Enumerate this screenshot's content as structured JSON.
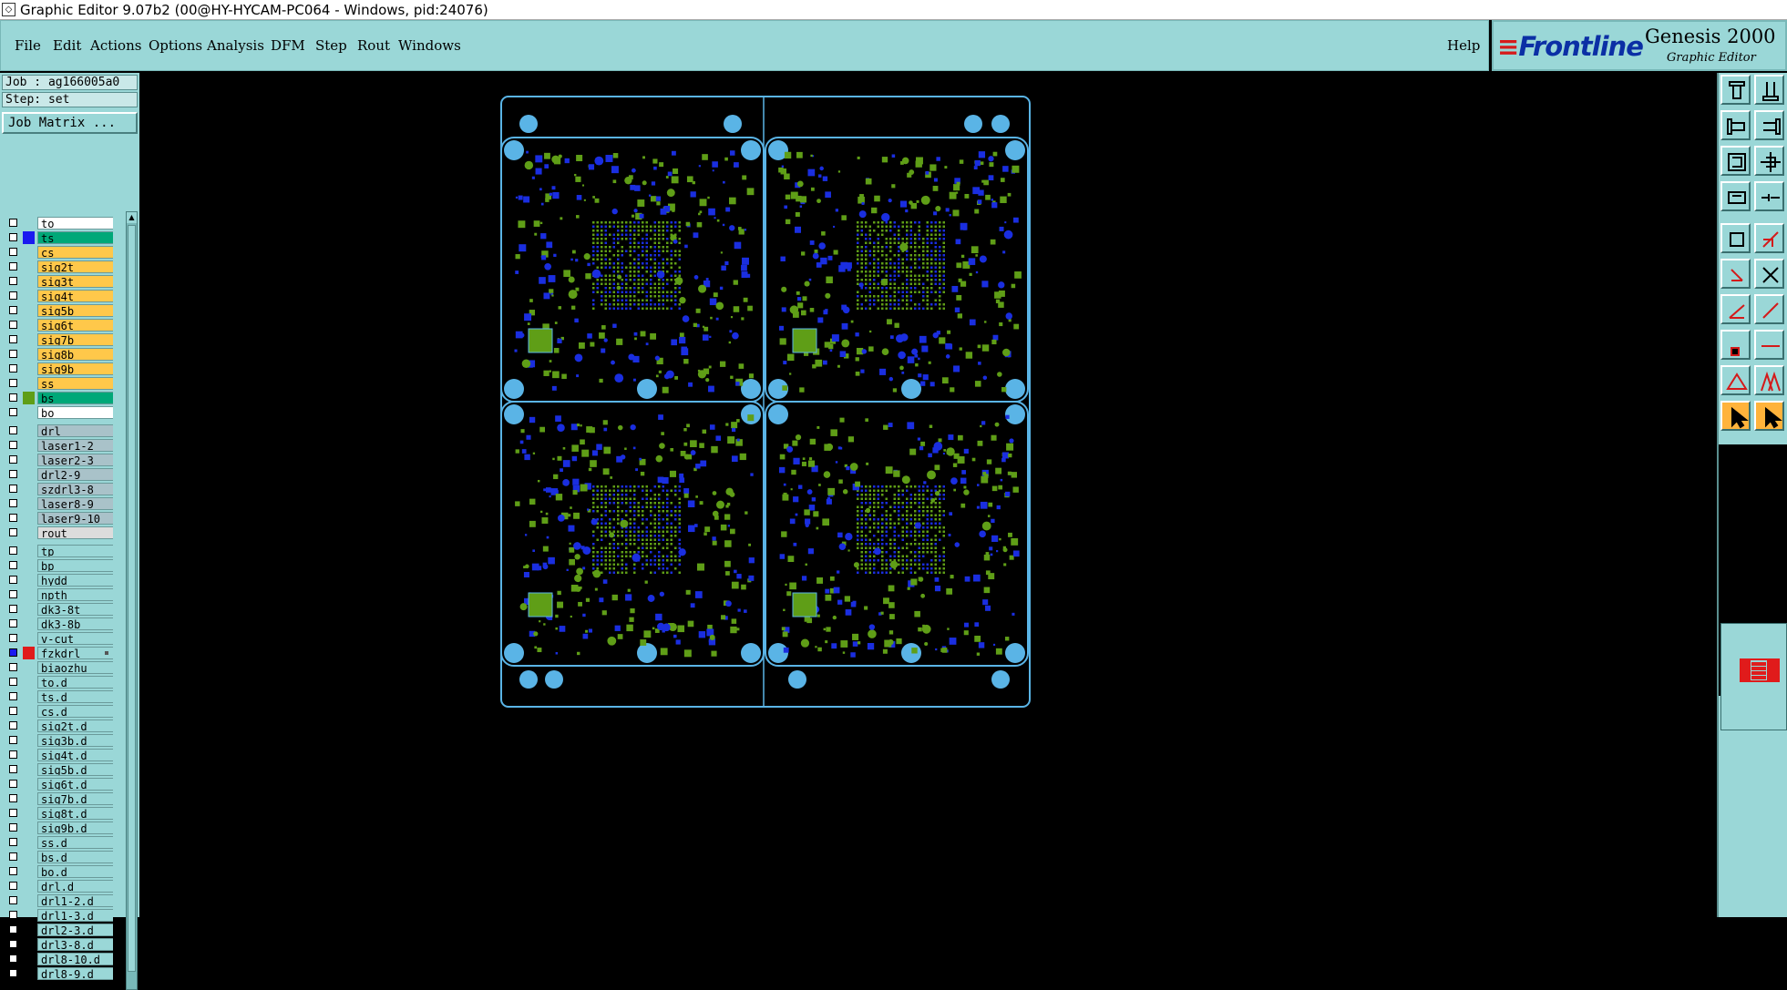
{
  "window": {
    "title": "Graphic Editor 9.07b2 (00@HY-HYCAM-PC064 - Windows, pid:24076)"
  },
  "menu": {
    "items": [
      "File",
      "Edit",
      "Actions",
      "Options",
      "Analysis",
      "DFM",
      "Step",
      "Rout",
      "Windows"
    ],
    "help": "Help"
  },
  "logo": {
    "brand": "Frontline",
    "product": "Genesis 2000",
    "subtitle": "Graphic Editor"
  },
  "job": {
    "job_label": "Job : ag166005a0",
    "step_label": "Step: set",
    "matrix_button": "Job Matrix ..."
  },
  "colors": {
    "panel": "#9ad7d7",
    "pad_green": "#5f9e17",
    "pad_blue": "#1a2ee0",
    "outline": "#5ab4e6",
    "highlight": "#ffb33b"
  },
  "layers": {
    "board": [
      {
        "name": "to",
        "bg": "#ffffff",
        "swatch": "",
        "checked": false
      },
      {
        "name": "ts",
        "bg": "#00a878",
        "swatch": "#1a1af0",
        "checked": false
      },
      {
        "name": "cs",
        "bg": "#ffc84a",
        "swatch": "",
        "checked": false
      },
      {
        "name": "sig2t",
        "bg": "#ffc84a",
        "swatch": "",
        "checked": false
      },
      {
        "name": "sig3t",
        "bg": "#ffc84a",
        "swatch": "",
        "checked": false
      },
      {
        "name": "sig4t",
        "bg": "#ffc84a",
        "swatch": "",
        "checked": false
      },
      {
        "name": "sig5b",
        "bg": "#ffc84a",
        "swatch": "",
        "checked": false
      },
      {
        "name": "sig6t",
        "bg": "#ffc84a",
        "swatch": "",
        "checked": false
      },
      {
        "name": "sig7b",
        "bg": "#ffc84a",
        "swatch": "",
        "checked": false
      },
      {
        "name": "sig8b",
        "bg": "#ffc84a",
        "swatch": "",
        "checked": false
      },
      {
        "name": "sig9b",
        "bg": "#ffc84a",
        "swatch": "",
        "checked": false
      },
      {
        "name": "ss",
        "bg": "#ffc84a",
        "swatch": "",
        "checked": false
      },
      {
        "name": "bs",
        "bg": "#00a878",
        "swatch": "#5f9e17",
        "checked": false
      },
      {
        "name": "bo",
        "bg": "#ffffff",
        "swatch": "",
        "checked": false
      }
    ],
    "drill": [
      {
        "name": "drl",
        "bg": "#a9c2c9",
        "swatch": "",
        "checked": false
      },
      {
        "name": "laser1-2",
        "bg": "#a9c2c9",
        "swatch": "",
        "checked": false
      },
      {
        "name": "laser2-3",
        "bg": "#a9c2c9",
        "swatch": "",
        "checked": false
      },
      {
        "name": "drl2-9",
        "bg": "#a9c2c9",
        "swatch": "",
        "checked": false
      },
      {
        "name": "szdrl3-8",
        "bg": "#a9c2c9",
        "swatch": "",
        "checked": false
      },
      {
        "name": "laser8-9",
        "bg": "#a9c2c9",
        "swatch": "",
        "checked": false
      },
      {
        "name": "laser9-10",
        "bg": "#a9c2c9",
        "swatch": "",
        "checked": false
      },
      {
        "name": "rout",
        "bg": "#dcdcdc",
        "swatch": "",
        "checked": false
      }
    ],
    "misc": [
      {
        "name": "tp",
        "bg": "#9ad7d7",
        "swatch": "",
        "checked": false
      },
      {
        "name": "bp",
        "bg": "#9ad7d7",
        "swatch": "",
        "checked": false
      },
      {
        "name": "hydd",
        "bg": "#9ad7d7",
        "swatch": "",
        "checked": false
      },
      {
        "name": "npth",
        "bg": "#9ad7d7",
        "swatch": "",
        "checked": false
      },
      {
        "name": "dk3-8t",
        "bg": "#9ad7d7",
        "swatch": "",
        "checked": false
      },
      {
        "name": "dk3-8b",
        "bg": "#9ad7d7",
        "swatch": "",
        "checked": false
      },
      {
        "name": "v-cut",
        "bg": "#9ad7d7",
        "swatch": "",
        "checked": false
      },
      {
        "name": "fzkdrl",
        "bg": "#9ad7d7",
        "swatch": "#e01b1b",
        "checked": true
      },
      {
        "name": "biaozhu",
        "bg": "#9ad7d7",
        "swatch": "",
        "checked": false
      },
      {
        "name": "to.d",
        "bg": "#9ad7d7",
        "swatch": "",
        "checked": false
      },
      {
        "name": "ts.d",
        "bg": "#9ad7d7",
        "swatch": "",
        "checked": false
      },
      {
        "name": "cs.d",
        "bg": "#9ad7d7",
        "swatch": "",
        "checked": false
      },
      {
        "name": "sig2t.d",
        "bg": "#9ad7d7",
        "swatch": "",
        "checked": false
      },
      {
        "name": "sig3b.d",
        "bg": "#9ad7d7",
        "swatch": "",
        "checked": false
      },
      {
        "name": "sig4t.d",
        "bg": "#9ad7d7",
        "swatch": "",
        "checked": false
      },
      {
        "name": "sig5b.d",
        "bg": "#9ad7d7",
        "swatch": "",
        "checked": false
      },
      {
        "name": "sig6t.d",
        "bg": "#9ad7d7",
        "swatch": "",
        "checked": false
      },
      {
        "name": "sig7b.d",
        "bg": "#9ad7d7",
        "swatch": "",
        "checked": false
      },
      {
        "name": "sig8t.d",
        "bg": "#9ad7d7",
        "swatch": "",
        "checked": false
      },
      {
        "name": "sig9b.d",
        "bg": "#9ad7d7",
        "swatch": "",
        "checked": false
      },
      {
        "name": "ss.d",
        "bg": "#9ad7d7",
        "swatch": "",
        "checked": false
      },
      {
        "name": "bs.d",
        "bg": "#9ad7d7",
        "swatch": "",
        "checked": false
      },
      {
        "name": "bo.d",
        "bg": "#9ad7d7",
        "swatch": "",
        "checked": false
      },
      {
        "name": "drl.d",
        "bg": "#9ad7d7",
        "swatch": "",
        "checked": false
      },
      {
        "name": "drl1-2.d",
        "bg": "#9ad7d7",
        "swatch": "",
        "checked": false
      },
      {
        "name": "drl1-3.d",
        "bg": "#9ad7d7",
        "swatch": "",
        "checked": false
      },
      {
        "name": "drl2-3.d",
        "bg": "#9ad7d7",
        "swatch": "",
        "checked": false
      },
      {
        "name": "drl3-8.d",
        "bg": "#9ad7d7",
        "swatch": "",
        "checked": false
      },
      {
        "name": "drl8-10.d",
        "bg": "#9ad7d7",
        "swatch": "",
        "checked": false
      },
      {
        "name": "drl8-9.d",
        "bg": "#9ad7d7",
        "swatch": "",
        "checked": false
      }
    ]
  },
  "toolbar_icons": [
    "panel-up-icon",
    "panel-down-icon",
    "panel-left-icon",
    "panel-right-icon",
    "zoom-fit-icon",
    "zoom-center-icon",
    "snapshot-icon",
    "measure-icon",
    "select-point-icon",
    "select-region-icon",
    "route-net-icon",
    "cross-icon",
    "angle-icon",
    "line-icon",
    "pad-icon",
    "line-dash-icon",
    "triangle-icon",
    "double-triangle-icon",
    "pointer-icon",
    "pointer-select-icon"
  ]
}
